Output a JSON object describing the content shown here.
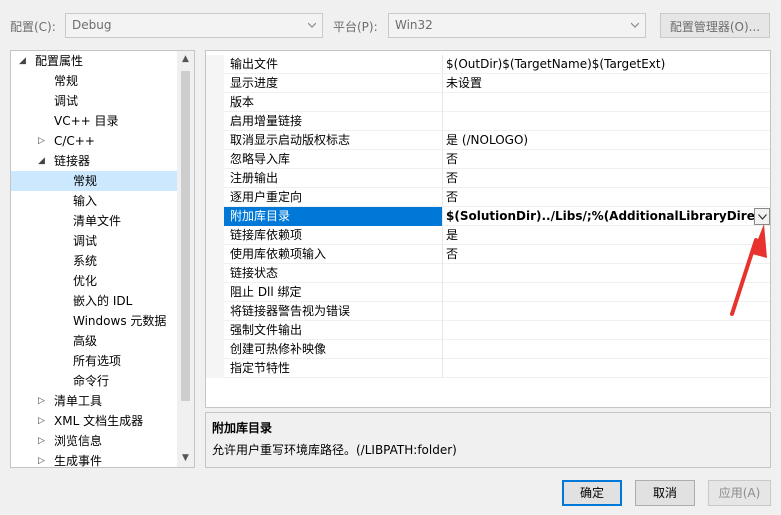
{
  "toolbar": {
    "config_label": "配置(C):",
    "config_value": "Debug",
    "platform_label": "平台(P):",
    "platform_value": "Win32",
    "manager_button": "配置管理器(O)..."
  },
  "tree": {
    "items": [
      {
        "label": "配置属性",
        "expander": "◢"
      },
      {
        "label": "常规"
      },
      {
        "label": "调试"
      },
      {
        "label": "VC++ 目录"
      },
      {
        "label": "C/C++",
        "expander": "▷"
      },
      {
        "label": "链接器",
        "expander": "◢"
      },
      {
        "label": "常规"
      },
      {
        "label": "输入"
      },
      {
        "label": "清单文件"
      },
      {
        "label": "调试"
      },
      {
        "label": "系统"
      },
      {
        "label": "优化"
      },
      {
        "label": "嵌入的 IDL"
      },
      {
        "label": "Windows 元数据"
      },
      {
        "label": "高级"
      },
      {
        "label": "所有选项"
      },
      {
        "label": "命令行"
      },
      {
        "label": "清单工具",
        "expander": "▷"
      },
      {
        "label": "XML 文档生成器",
        "expander": "▷"
      },
      {
        "label": "浏览信息",
        "expander": "▷"
      },
      {
        "label": "生成事件",
        "expander": "▷"
      }
    ],
    "scroll_up": "▲",
    "scroll_down": "▼"
  },
  "grid": {
    "rows": [
      {
        "name": "输出文件",
        "value": "$(OutDir)$(TargetName)$(TargetExt)"
      },
      {
        "name": "显示进度",
        "value": "未设置"
      },
      {
        "name": "版本",
        "value": ""
      },
      {
        "name": "启用增量链接",
        "value": ""
      },
      {
        "name": "取消显示启动版权标志",
        "value": "是 (/NOLOGO)"
      },
      {
        "name": "忽略导入库",
        "value": "否"
      },
      {
        "name": "注册输出",
        "value": "否"
      },
      {
        "name": "逐用户重定向",
        "value": "否"
      },
      {
        "name": "附加库目录",
        "value": "$(SolutionDir)../Libs/;%(AdditionalLibraryDirectories)"
      },
      {
        "name": "链接库依赖项",
        "value": "是"
      },
      {
        "name": "使用库依赖项输入",
        "value": "否"
      },
      {
        "name": "链接状态",
        "value": ""
      },
      {
        "name": "阻止 Dll 绑定",
        "value": ""
      },
      {
        "name": "将链接器警告视为错误",
        "value": ""
      },
      {
        "name": "强制文件输出",
        "value": ""
      },
      {
        "name": "创建可热修补映像",
        "value": ""
      },
      {
        "name": "指定节特性",
        "value": ""
      }
    ]
  },
  "description": {
    "title": "附加库目录",
    "text": "允许用户重写环境库路径。(/LIBPATH:folder)"
  },
  "buttons": {
    "ok": "确定",
    "cancel": "取消",
    "apply": "应用(A)"
  },
  "colors": {
    "selection": "#0078d7",
    "tree_selection": "#cce8ff",
    "annotation_arrow": "#e8322e"
  }
}
